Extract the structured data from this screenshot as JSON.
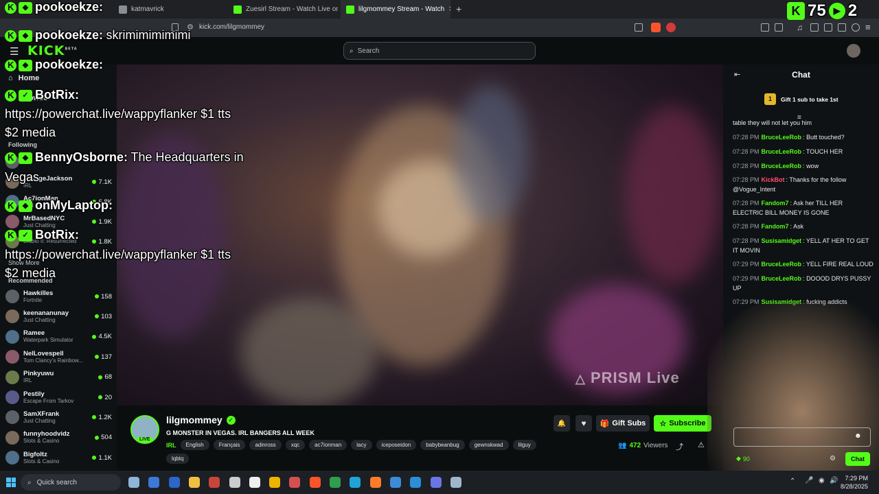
{
  "browser": {
    "tabs": [
      {
        "label": "katmavrick"
      },
      {
        "label": "Zuesirl Stream - Watch Live on Kick"
      },
      {
        "label": "lilgmommey Stream - Watch"
      }
    ],
    "url": "kick.com/lilgmommey"
  },
  "overlay_top": {
    "icon": "green-k-logo",
    "count1": "75",
    "count2": "2"
  },
  "site": {
    "logo": "KICK",
    "logo_badge": "BETA",
    "search_placeholder": "Search"
  },
  "sidebar": {
    "nav": [
      {
        "label": "Home"
      },
      {
        "label": "Browse"
      }
    ],
    "following_label": "Following",
    "following": [
      {
        "name": "",
        "category": "IRL",
        "viewers": ""
      },
      {
        "name": "SavageJackson",
        "category": "IRL",
        "viewers": "7.1K"
      },
      {
        "name": "Ac7ionMan",
        "category": "Just Chatting",
        "viewers": "6.8K"
      },
      {
        "name": "MrBasedNYC",
        "category": "Just Chatting",
        "viewers": "1.9K"
      },
      {
        "name": "",
        "category": "Diablo II: Resurrected",
        "viewers": "1.8K"
      }
    ],
    "show_more": "Show More",
    "recommended_label": "Recommended",
    "recommended": [
      {
        "name": "Hawkilles",
        "category": "Fortnite",
        "viewers": "158"
      },
      {
        "name": "keenananunay",
        "category": "Just Chatting",
        "viewers": "103"
      },
      {
        "name": "Ramee",
        "category": "Waterpark Simulator",
        "viewers": "4.5K"
      },
      {
        "name": "NelLovespell",
        "category": "Tom Clancy's Rainbow...",
        "viewers": "137"
      },
      {
        "name": "Pinkyuwu",
        "category": "IRL",
        "viewers": "68"
      },
      {
        "name": "Pestily",
        "category": "Escape From Tarkov",
        "viewers": "20"
      },
      {
        "name": "SamXFrank",
        "category": "Just Chatting",
        "viewers": "1.2K"
      },
      {
        "name": "funnyhoodvidz",
        "category": "Slots & Casino",
        "viewers": "504"
      },
      {
        "name": "Bigfoltz",
        "category": "Slots & Casino",
        "viewers": "1.1K"
      }
    ]
  },
  "video": {
    "watermark": "PRISM Live"
  },
  "stream": {
    "channel": "lilgmommey",
    "title": "G MONSTER IN VEGAS. IRL BANGERS ALL WEEK",
    "live_label": "LIVE",
    "category": "IRL",
    "tags": [
      "English",
      "Français",
      "adinross",
      "xqc",
      "ac7ionman",
      "lacy",
      "iceposeidon",
      "babybeanbug",
      "gewnskwad",
      "lilguy",
      "lqbtq"
    ],
    "viewers": "472",
    "viewers_label": "Viewers",
    "gift_label": "Gift Subs",
    "subscribe_label": "Subscribe"
  },
  "chat": {
    "title": "Chat",
    "gift_prompt": "Gift 1 sub to take 1st",
    "gift_count": "1",
    "partial_line": "table they will not let you him",
    "messages": [
      {
        "time": "07:28 PM",
        "user": "BruceLeeRob",
        "color": "#53fc18",
        "text": "Butt touched?"
      },
      {
        "time": "07:28 PM",
        "user": "BruceLeeRob",
        "color": "#53fc18",
        "text": "TOUCH HER"
      },
      {
        "time": "07:28 PM",
        "user": "BruceLeeRob",
        "color": "#53fc18",
        "text": "wow"
      },
      {
        "time": "07:28 PM",
        "user": "KickBot",
        "color": "#ff4d6a",
        "text": "Thanks for the follow @Vogue_Intent"
      },
      {
        "time": "07:28 PM",
        "user": "Fandom7",
        "color": "#53fc18",
        "text": "Ask her TILL HER ELECTRIC BILL MONEY IS GONE"
      },
      {
        "time": "07:28 PM",
        "user": "Fandom7",
        "color": "#53fc18",
        "text": "Ask"
      },
      {
        "time": "07:28 PM",
        "user": "Susisamidget",
        "color": "#53fc18",
        "text": "YELL AT HER TO GET IT MOVIN"
      },
      {
        "time": "07:29 PM",
        "user": "BruceLeeRob",
        "color": "#53fc18",
        "text": "YELL FIRE REAL LOUD"
      },
      {
        "time": "07:29 PM",
        "user": "BruceLeeRob",
        "color": "#53fc18",
        "text": "DOOOD DRYS PUSSY UP"
      },
      {
        "time": "07:29 PM",
        "user": "Susisamidget",
        "color": "#53fc18",
        "text": "fucking addicts"
      }
    ],
    "points": "90",
    "chat_button": "Chat"
  },
  "overlay_chat": [
    {
      "user": "pookoekze:",
      "text": ""
    },
    {
      "user": "pookoekze:",
      "text": "skrimimimimimi"
    },
    {
      "user": "pookoekze:",
      "text": ""
    },
    {
      "user": "BotRix:",
      "text": "https://powerchat.live/wappyflanker $1 tts",
      "text2": "$2 media"
    },
    {
      "user": "BennyOsborne:",
      "text": "The Headquarters in",
      "text2": "Vegas"
    },
    {
      "user": "onMyLaptop:",
      "text": ""
    },
    {
      "user": "BotRix:",
      "text": "https://powerchat.live/wappyflanker $1 tts",
      "text2": "$2 media"
    }
  ],
  "taskbar": {
    "search_placeholder": "Quick search",
    "time": "7:29 PM",
    "date": "8/28/2025"
  },
  "colors": {
    "accent": "#53fc18",
    "background": "#0b0e0f",
    "panel": "#0f1214"
  }
}
